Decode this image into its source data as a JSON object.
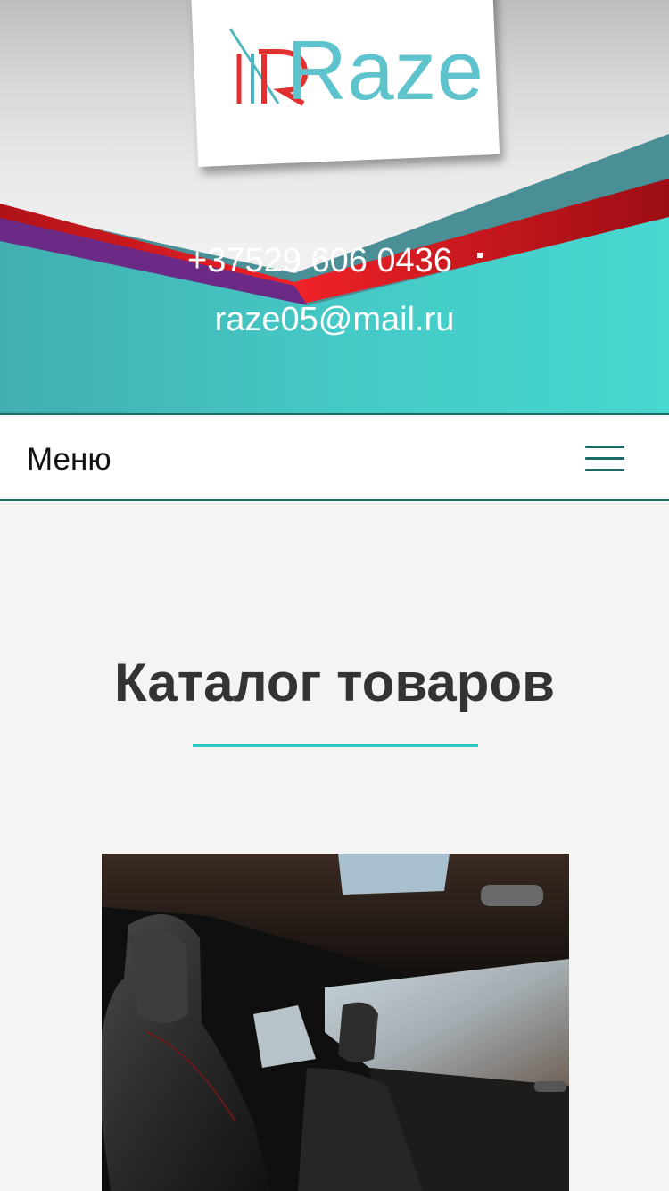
{
  "header": {
    "logo_text": "Raze",
    "phone": "+37529 606 0436",
    "email": "raze05@mail.ru"
  },
  "menu": {
    "label": "Меню"
  },
  "main": {
    "title": "Каталог товаров"
  },
  "colors": {
    "teal": "#47d5cf",
    "dark_teal": "#1b6b67",
    "red": "#d81f26",
    "purple": "#6b2a86",
    "underline": "#38c6c9",
    "title_text": "#333333"
  },
  "icons": [
    "menu-hamburger-icon"
  ]
}
